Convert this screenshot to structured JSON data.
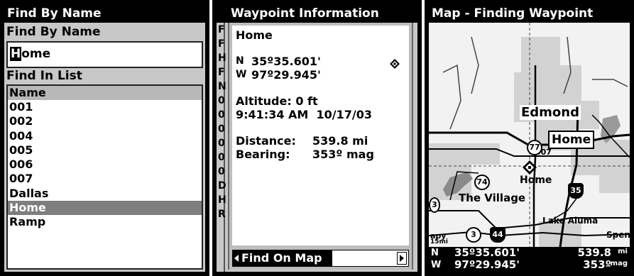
{
  "panel1": {
    "title": "Find By Name",
    "field_label": "Find By Name",
    "field_value_cursor": "H",
    "field_value_rest": "ome",
    "list_label": "Find In List",
    "list_header": "Name",
    "items": [
      "001",
      "002",
      "004",
      "005",
      "006",
      "007",
      "Dallas",
      "Home",
      "Ramp"
    ],
    "selected": "Home"
  },
  "panel2": {
    "title": "Waypoint Information",
    "ghost_letters": [
      "F",
      "F",
      "H",
      "F",
      "N",
      "0",
      "0",
      "0",
      "0",
      "0",
      "0",
      "D",
      "H",
      "R"
    ],
    "name": "Home",
    "lat_label": "N",
    "lat": "35º35.601'",
    "lon_label": "W",
    "lon": "97º29.945'",
    "altitude": "Altitude: 0 ft",
    "datetime": "9:41:34 AM  10/17/03",
    "distance_label": "Distance:",
    "distance": "539.8 mi",
    "bearing_label": "Bearing:",
    "bearing": "353º mag",
    "button": "Find On Map"
  },
  "panel3": {
    "title": "Map - Finding Waypoint",
    "labels": {
      "edmond": "Edmond",
      "home_box": "Home",
      "home_wp": "Home",
      "village": "The Village",
      "lake": "Lake Aluma",
      "spen": "Spen",
      "num007": "007",
      "scale": "15mi",
      "abbr": "apy"
    },
    "shields": {
      "us77": "77",
      "sh74": "74",
      "i35": "35",
      "sh3a": "3",
      "sh3b": "3",
      "i44": "44"
    },
    "status": {
      "lat_label": "N",
      "lat": "35º35.601'",
      "lon_label": "W",
      "lon": "97º29.945'",
      "distance": "539.8",
      "distance_unit": "mi",
      "bearing": "353º",
      "bearing_unit": "mag"
    }
  }
}
